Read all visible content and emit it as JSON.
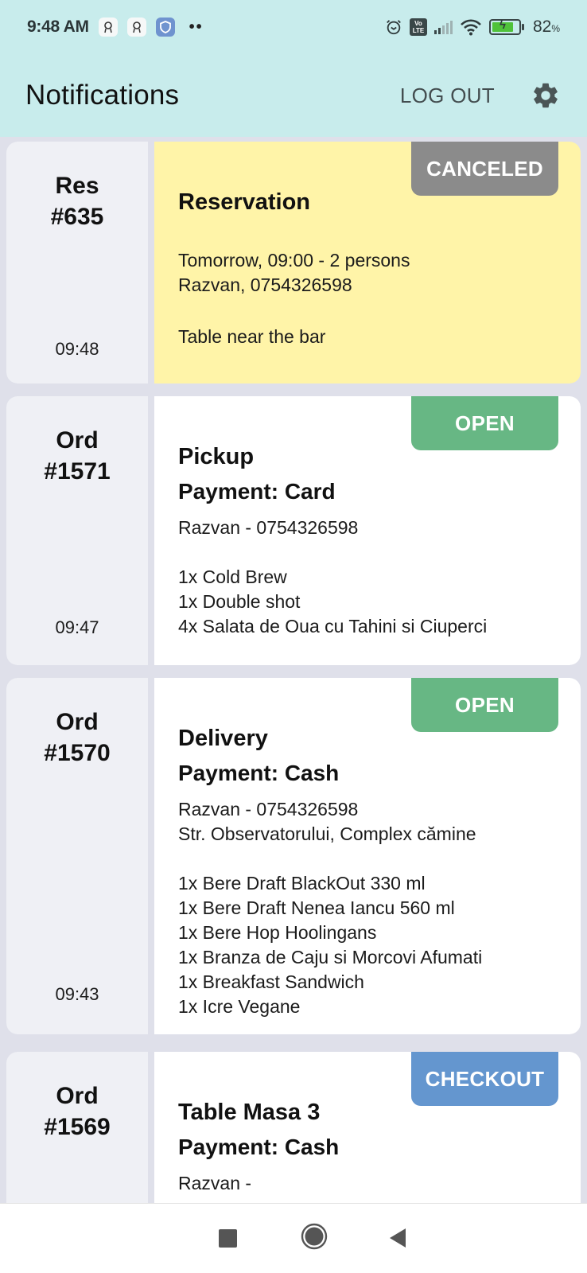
{
  "status_bar": {
    "time": "9:48 AM",
    "notification_icons": [
      "award-icon",
      "award-icon",
      "shield-icon"
    ],
    "overflow": "••",
    "network": "VoLTE",
    "battery_percent": 82,
    "battery_label": "82",
    "percent_sign": "%"
  },
  "app_bar": {
    "title": "Notifications",
    "logout_label": "LOG OUT",
    "settings_icon": "gear-icon"
  },
  "colors": {
    "header_bg": "#c8ecec",
    "reservation_bg": "#fff4a8",
    "badge_canceled": "#8b8b8b",
    "badge_open": "#67b784",
    "badge_checkout": "#6496cf"
  },
  "notifications": [
    {
      "ref_type": "Res",
      "ref_number": "#635",
      "time": "09:48",
      "status": "CANCELED",
      "title": "Reservation",
      "lines": [
        "Tomorrow, 09:00 - 2 persons",
        "Razvan, 0754326598"
      ],
      "note": "Table near the bar"
    },
    {
      "ref_type": "Ord",
      "ref_number": "#1571",
      "time": "09:47",
      "status": "OPEN",
      "title": "Pickup",
      "payment": "Payment: Card",
      "customer": "Razvan - 0754326598",
      "items": [
        "1x Cold Brew",
        "1x Double shot",
        "4x Salata de Oua cu Tahini si Ciuperci"
      ]
    },
    {
      "ref_type": "Ord",
      "ref_number": "#1570",
      "time": "09:43",
      "status": "OPEN",
      "title": "Delivery",
      "payment": "Payment: Cash",
      "customer": "Razvan - 0754326598",
      "address": "Str. Observatorului, Complex cămine",
      "items": [
        "1x Bere Draft BlackOut 330 ml",
        "1x Bere Draft Nenea Iancu 560 ml",
        "1x Bere Hop Hoolingans",
        "1x Branza de Caju si Morcovi Afumati",
        "1x Breakfast Sandwich",
        "1x Icre Vegane"
      ]
    },
    {
      "ref_type": "Ord",
      "ref_number": "#1569",
      "status": "CHECKOUT",
      "title": "Table Masa 3",
      "payment": "Payment: Cash",
      "customer": "Razvan -"
    }
  ],
  "nav_bar": {
    "recents": "recents-button",
    "home": "home-button",
    "back": "back-button"
  }
}
